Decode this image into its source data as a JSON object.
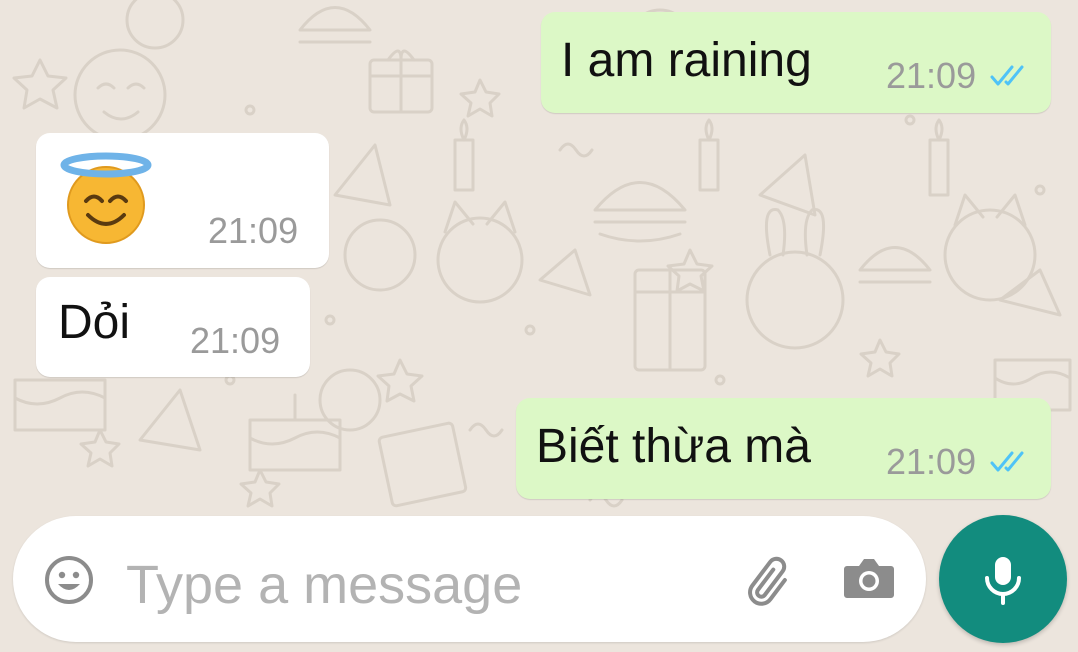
{
  "messages": [
    {
      "direction": "outgoing",
      "text": "I am raining",
      "time": "21:09",
      "status": "read"
    },
    {
      "direction": "incoming",
      "emoji": "😇",
      "time": "21:09"
    },
    {
      "direction": "incoming",
      "text": "Dỏi",
      "time": "21:09"
    },
    {
      "direction": "outgoing",
      "text": "Biết thừa mà",
      "time": "21:09",
      "status": "read"
    }
  ],
  "composer": {
    "placeholder": "Type a message",
    "emoji_icon": "smiley-icon",
    "attach_icon": "paperclip-icon",
    "camera_icon": "camera-icon",
    "send_icon": "microphone-icon"
  },
  "colors": {
    "wallpaper": "#ece5dd",
    "outgoing_bubble": "#dcf8c6",
    "incoming_bubble": "#ffffff",
    "read_ticks": "#4fc3f7",
    "accent": "#128c7e"
  }
}
